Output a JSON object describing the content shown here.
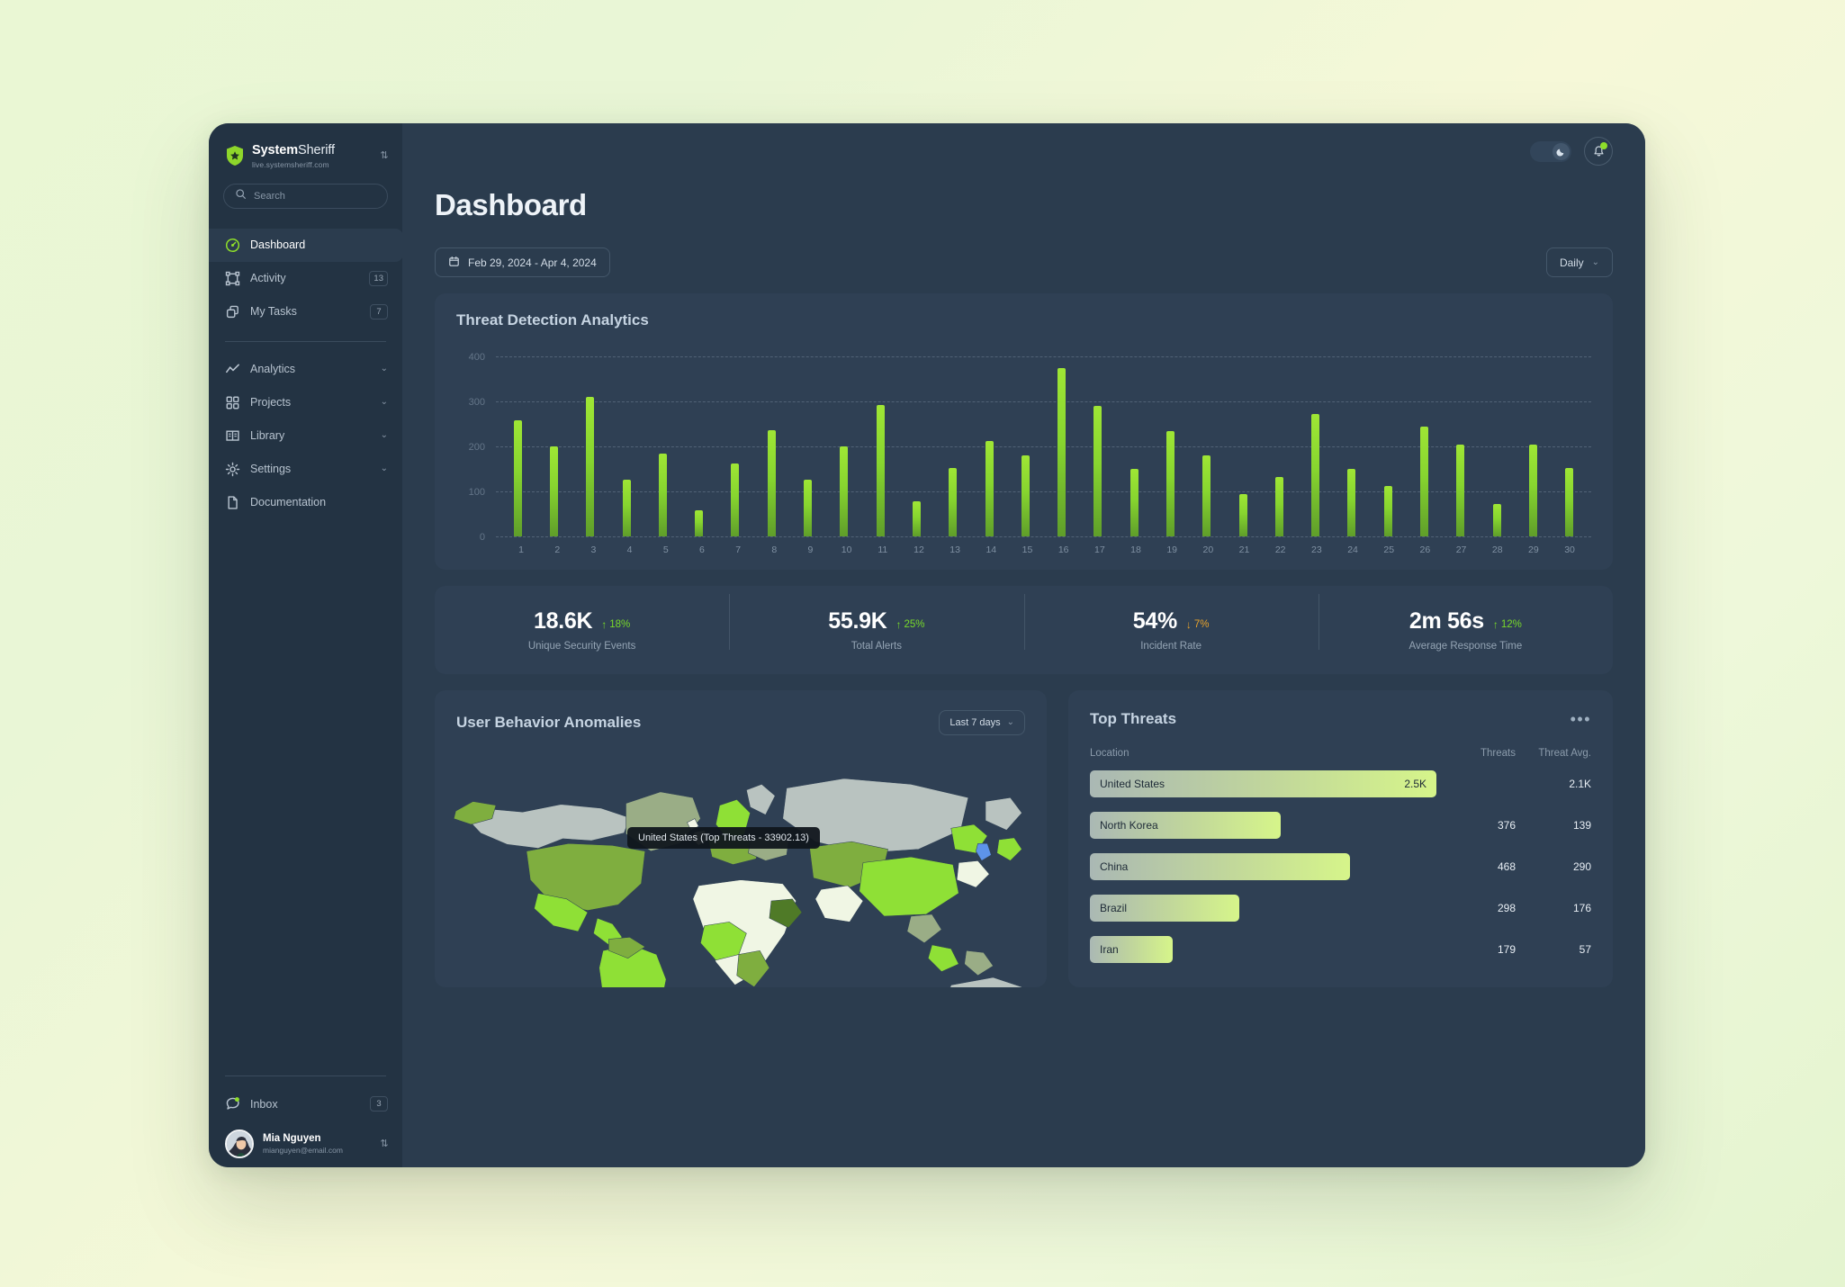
{
  "brand": {
    "name_bold": "System",
    "name_light": "Sheriff",
    "url": "live.systemsheriff.com",
    "logo_icon": "shield-star-icon",
    "switcher_icon": "chevron-up-down-icon"
  },
  "search": {
    "placeholder": "Search",
    "value": "",
    "icon": "search-icon"
  },
  "sidebar": {
    "primary_items": [
      {
        "label": "Dashboard",
        "icon": "gauge-icon",
        "active": true,
        "badge": ""
      },
      {
        "label": "Activity",
        "icon": "frame-icon",
        "active": false,
        "badge": "13"
      },
      {
        "label": "My Tasks",
        "icon": "copy-icon",
        "active": false,
        "badge": "7"
      }
    ],
    "secondary_items": [
      {
        "label": "Analytics",
        "icon": "trend-line-icon",
        "chevron": "chevron-down-icon"
      },
      {
        "label": "Projects",
        "icon": "grid-icon",
        "chevron": "chevron-down-icon"
      },
      {
        "label": "Library",
        "icon": "book-icon",
        "chevron": "chevron-down-icon"
      },
      {
        "label": "Settings",
        "icon": "gear-icon",
        "chevron": "chevron-down-icon"
      },
      {
        "label": "Documentation",
        "icon": "file-icon",
        "chevron": ""
      }
    ],
    "inbox": {
      "label": "Inbox",
      "icon": "chat-bubble-icon",
      "badge": "3",
      "has_dot": true
    },
    "user": {
      "name": "Mia Nguyen",
      "email": "mianguyen@email.com",
      "avatar_icon": "user-avatar",
      "switcher_icon": "chevron-up-down-icon"
    }
  },
  "topbar": {
    "theme_toggle": {
      "icon": "moon-icon",
      "state": "dark"
    },
    "notifications": {
      "icon": "bell-icon",
      "has_unread": true
    }
  },
  "header": {
    "title": "Dashboard"
  },
  "controls": {
    "date_range": {
      "label": "Feb 29, 2024 - Apr 4, 2024",
      "icon": "calendar-icon"
    },
    "granularity": {
      "label": "Daily",
      "icon": "chevron-down-icon"
    }
  },
  "chart_data": {
    "type": "bar",
    "title": "Threat Detection Analytics",
    "xlabel": "",
    "ylabel": "",
    "ylim": [
      0,
      400
    ],
    "yticks": [
      0,
      100,
      200,
      300,
      400
    ],
    "grid": true,
    "legend": "none",
    "categories": [
      "1",
      "2",
      "3",
      "4",
      "5",
      "6",
      "7",
      "8",
      "9",
      "10",
      "11",
      "12",
      "13",
      "14",
      "15",
      "16",
      "17",
      "18",
      "19",
      "20",
      "21",
      "22",
      "23",
      "24",
      "25",
      "26",
      "27",
      "28",
      "29",
      "30"
    ],
    "values": [
      258,
      200,
      310,
      127,
      185,
      58,
      162,
      237,
      126,
      200,
      292,
      78,
      152,
      212,
      180,
      375,
      290,
      150,
      235,
      180,
      95,
      132,
      272,
      150,
      112,
      245,
      205,
      72,
      205,
      152
    ],
    "bar_color_top": "#9fe635",
    "bar_color_bottom": "#5f9e2a"
  },
  "stats": [
    {
      "value": "18.6K",
      "delta": "18%",
      "direction": "up",
      "label": "Unique Security Events",
      "color": "#78d92a"
    },
    {
      "value": "55.9K",
      "delta": "25%",
      "direction": "up",
      "label": "Total Alerts",
      "color": "#78d92a"
    },
    {
      "value": "54%",
      "delta": "7%",
      "direction": "down",
      "label": "Incident Rate",
      "color": "#e8a32c"
    },
    {
      "value": "2m 56s",
      "delta": "12%",
      "direction": "up",
      "label": "Average Response Time",
      "color": "#78d92a"
    }
  ],
  "map_panel": {
    "title": "User Behavior Anomalies",
    "range_selector": {
      "label": "Last 7 days",
      "icon": "chevron-down-icon"
    },
    "tooltip": "United States (Top Threats - 33902.13)"
  },
  "threats_panel": {
    "title": "Top Threats",
    "menu_icon": "ellipsis-icon",
    "columns": {
      "location": "Location",
      "threats": "Threats",
      "avg": "Threat Avg."
    },
    "rows": [
      {
        "location": "United States",
        "threats": "2.5K",
        "avg": "2.1K",
        "bar_pct": 100,
        "value_inside": true
      },
      {
        "location": "North Korea",
        "threats": "376",
        "avg": "139",
        "bar_pct": 55,
        "value_inside": false
      },
      {
        "location": "China",
        "threats": "468",
        "avg": "290",
        "bar_pct": 75,
        "value_inside": false
      },
      {
        "location": "Brazil",
        "threats": "298",
        "avg": "176",
        "bar_pct": 43,
        "value_inside": false
      },
      {
        "location": "Iran",
        "threats": "179",
        "avg": "57",
        "bar_pct": 24,
        "value_inside": false
      }
    ]
  }
}
